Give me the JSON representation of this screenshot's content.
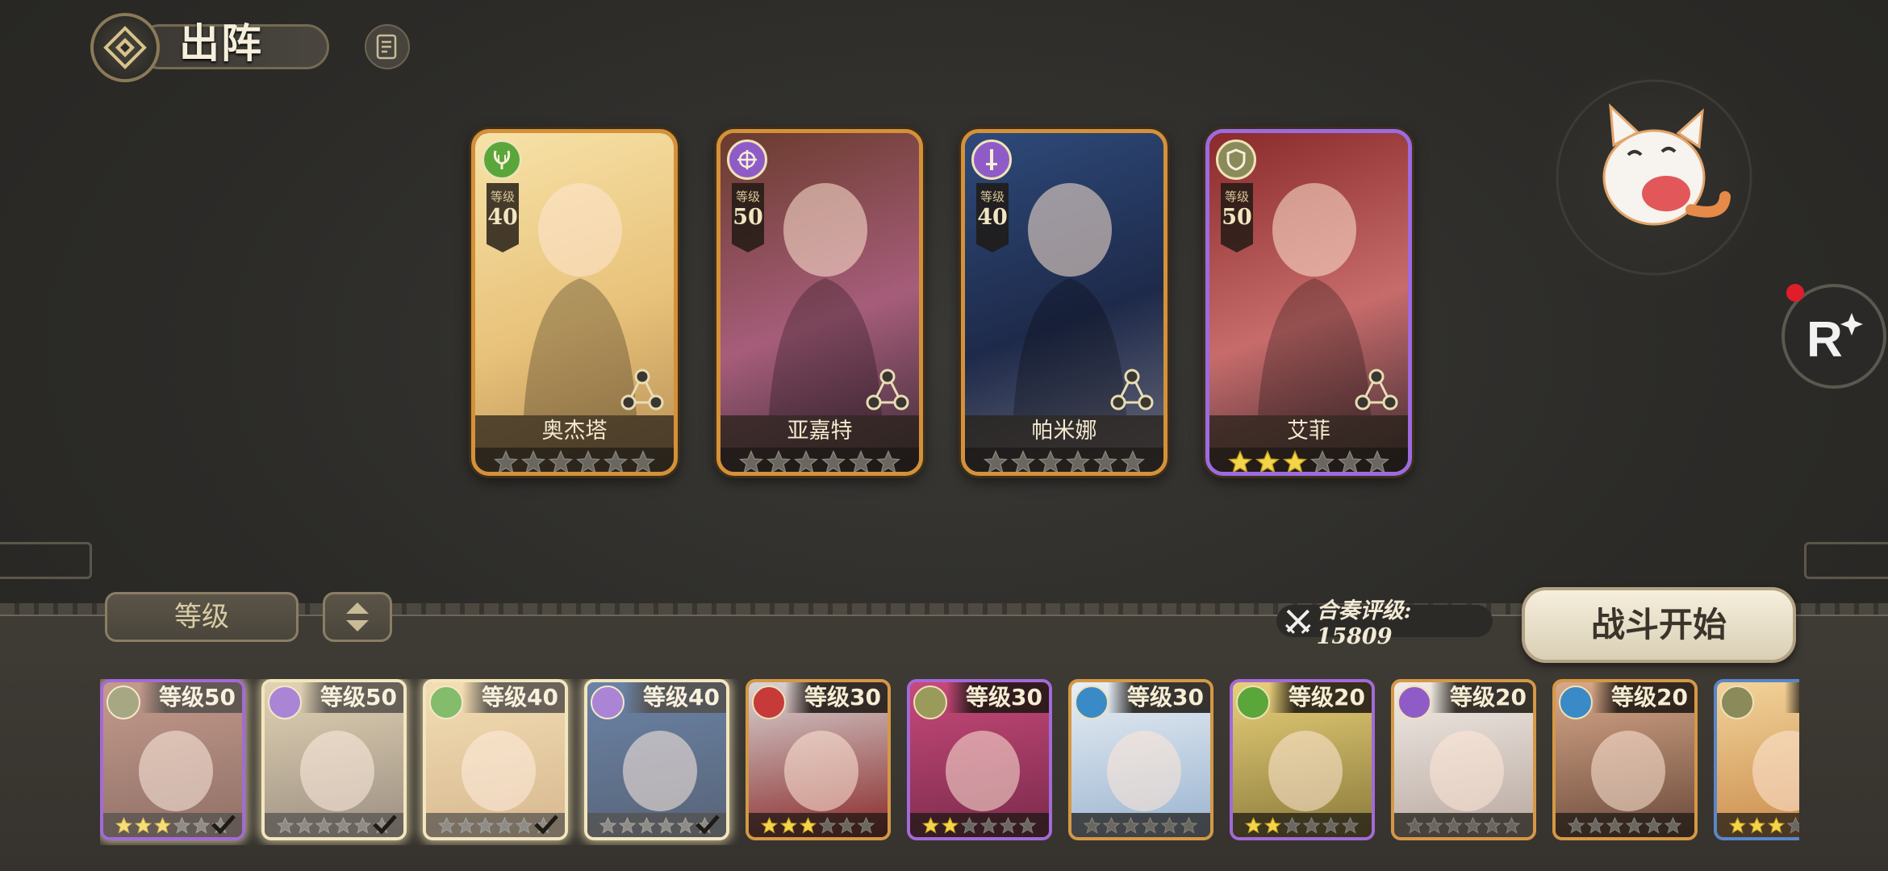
{
  "header": {
    "title": "出阵",
    "emblem_icon": "compass-emblem-icon",
    "doc_icon": "document-icon"
  },
  "team": [
    {
      "name": "奥杰塔",
      "level_label": "等级",
      "level": "40",
      "class": "lyre",
      "class_color": "#5aa63a",
      "stars": 0,
      "frame": "gold",
      "art": [
        "#f7e2a8",
        "#e8c27a",
        "#b78e55"
      ]
    },
    {
      "name": "亚嘉特",
      "level_label": "等级",
      "level": "50",
      "class": "crossbow",
      "class_color": "#8f5cc7",
      "stars": 0,
      "frame": "gold",
      "art": [
        "#6a3b2c",
        "#a65d7a",
        "#3a2a36"
      ]
    },
    {
      "name": "帕米娜",
      "level_label": "等级",
      "level": "40",
      "class": "sword",
      "class_color": "#8f5cc7",
      "stars": 0,
      "frame": "gold",
      "art": [
        "#2e4a7a",
        "#1e2a4a",
        "#6a6a7a"
      ]
    },
    {
      "name": "艾菲",
      "level_label": "等级",
      "level": "50",
      "class": "shield",
      "class_color": "#8a8a5a",
      "stars": 3,
      "frame": "purple",
      "art": [
        "#8a2a2a",
        "#c76b6b",
        "#3a2a30"
      ]
    }
  ],
  "sort": {
    "label": "等级",
    "order_icon": "sort-updown-icon"
  },
  "rating": {
    "text": "合奏评级: 15809",
    "icon": "crossed-swords-icon"
  },
  "start_button": "战斗开始",
  "roster": [
    {
      "level": "等级50",
      "stars": 3,
      "selected": true,
      "frame": "purple",
      "class_color": "#8a8a5a",
      "art": [
        "#b07a66",
        "#6a4034"
      ]
    },
    {
      "level": "等级50",
      "stars": 0,
      "selected": true,
      "frame": "gold",
      "class_color": "#8f5cc7",
      "art": [
        "#d8c49a",
        "#7a6a5a"
      ]
    },
    {
      "level": "等级40",
      "stars": 0,
      "selected": true,
      "frame": "gold",
      "class_color": "#5aa63a",
      "art": [
        "#f0d39a",
        "#c9a06a"
      ]
    },
    {
      "level": "等级40",
      "stars": 0,
      "selected": true,
      "frame": "gold",
      "class_color": "#8f5cc7",
      "art": [
        "#3a5a8a",
        "#20304a"
      ]
    },
    {
      "level": "等级30",
      "stars": 3,
      "selected": false,
      "frame": "gold",
      "class_color": "#c73a3a",
      "art": [
        "#d8d4d4",
        "#8a2a2a"
      ]
    },
    {
      "level": "等级30",
      "stars": 2,
      "selected": false,
      "frame": "purple",
      "class_color": "#9a9a5a",
      "art": [
        "#c74a7a",
        "#7a2a4a"
      ]
    },
    {
      "level": "等级30",
      "stars": 0,
      "selected": false,
      "frame": "gold",
      "class_color": "#3a8ac7",
      "art": [
        "#e8eef4",
        "#9ab4d0"
      ]
    },
    {
      "level": "等级20",
      "stars": 2,
      "selected": false,
      "frame": "purple",
      "class_color": "#5aa63a",
      "art": [
        "#e8d07a",
        "#8a7a3a"
      ]
    },
    {
      "level": "等级20",
      "stars": 0,
      "selected": false,
      "frame": "gold",
      "class_color": "#8f5cc7",
      "art": [
        "#f2ece6",
        "#b8a8a0"
      ]
    },
    {
      "level": "等级20",
      "stars": 0,
      "selected": false,
      "frame": "gold",
      "class_color": "#3a8ac7",
      "art": [
        "#d8a88a",
        "#6a4a3a"
      ]
    },
    {
      "level": "等级",
      "stars": 3,
      "selected": false,
      "frame": "blue",
      "class_color": "#8a8a5a",
      "art": [
        "#f2d39a",
        "#c98a4a"
      ]
    }
  ],
  "side": {
    "mascot": "lucky-cat-mascot-icon",
    "r_button_icon": "r-sparkle-icon",
    "notification_color": "#e01d2a"
  }
}
